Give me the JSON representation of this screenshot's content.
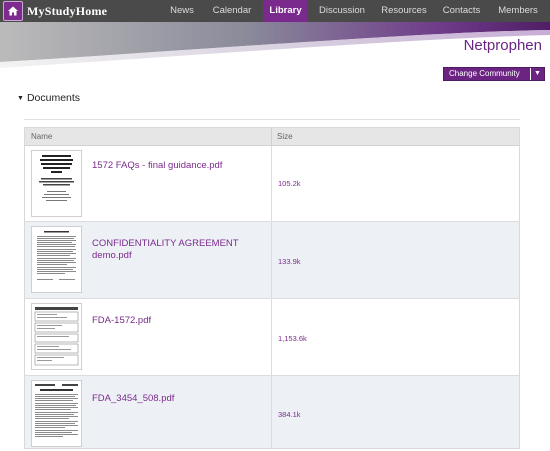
{
  "app": {
    "logo_text": "MyStudyHome"
  },
  "nav": {
    "items": [
      {
        "label": "News"
      },
      {
        "label": "Calendar"
      },
      {
        "label": "Library"
      },
      {
        "label": "Discussion"
      },
      {
        "label": "Resources"
      },
      {
        "label": "Contacts"
      },
      {
        "label": "Members"
      }
    ],
    "active": "Library"
  },
  "community": {
    "name": "Netprophen",
    "change_label": "Change Community"
  },
  "section": {
    "title": "Documents"
  },
  "table": {
    "columns": {
      "name": "Name",
      "size": "Size"
    },
    "rows": [
      {
        "name": "1572 FAQs - final guidance.pdf",
        "size": "105.2k",
        "thumb_text": "Information Sheet Guidance for Sponsors, Clinical Investigators, and IRBs — Frequently Asked Questions – Statement of Investigator (Form FDA 1572)"
      },
      {
        "name": "CONFIDENTIALITY AGREEMENT demo.pdf",
        "size": "133.9k"
      },
      {
        "name": "FDA-1572.pdf",
        "size": "1,153.6k"
      },
      {
        "name": "FDA_3454_508.pdf",
        "size": "384.1k"
      }
    ]
  },
  "colors": {
    "accent": "#7a2a8c",
    "nav_bg": "#4a4a4a",
    "row_alt": "#edf1f6"
  }
}
